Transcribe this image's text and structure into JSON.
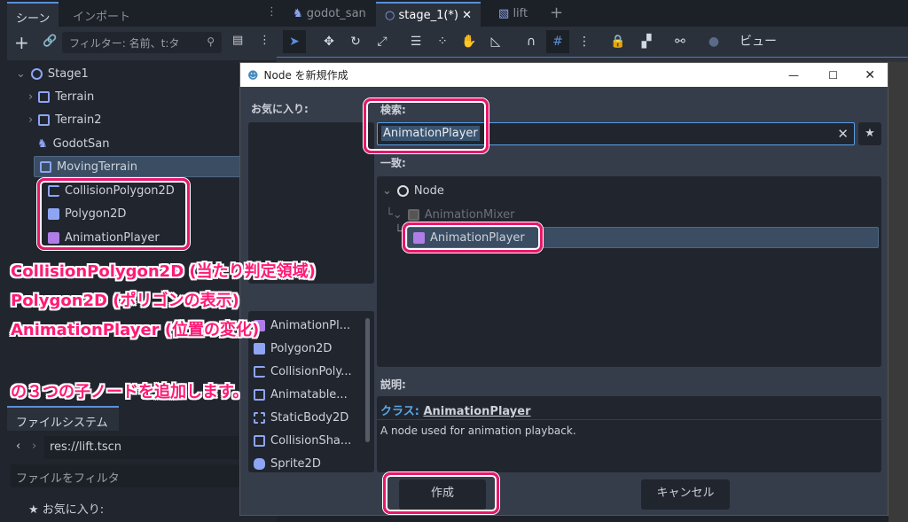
{
  "scene_dock": {
    "tabs": [
      "シーン",
      "インポート"
    ],
    "filter_placeholder": "フィルター: 名前、t:タ",
    "tree": [
      {
        "label": "Stage1"
      },
      {
        "label": "Terrain"
      },
      {
        "label": "Terrain2"
      },
      {
        "label": "GodotSan"
      },
      {
        "label": "MovingTerrain"
      },
      {
        "label": "CollisionPolygon2D"
      },
      {
        "label": "Polygon2D"
      },
      {
        "label": "AnimationPlayer"
      }
    ]
  },
  "annotations": [
    "CollisionPolygon2D (当たり判定領域)",
    "Polygon2D (ポリゴンの表示)",
    "AnimationPlayer (位置の変化)",
    "の３つの子ノードを追加します。"
  ],
  "filesystem": {
    "tab": "ファイルシステム",
    "path": "res://lift.tscn",
    "filter_placeholder": "ファイルをフィルタ",
    "favorites": "お気に入り:"
  },
  "editor": {
    "tabs": [
      "godot_san",
      "stage_1(*)",
      "lift"
    ],
    "view_menu": "ビュー"
  },
  "dialog": {
    "title": "Node を新規作成",
    "favorites_label": "お気に入り:",
    "search_label": "検索:",
    "search_value": "AnimationPlayer",
    "matches_label": "一致:",
    "matches": [
      "Node",
      "AnimationMixer",
      "AnimationPlayer"
    ],
    "recent": [
      "AnimationPl...",
      "Polygon2D",
      "CollisionPoly...",
      "Animatable...",
      "StaticBody2D",
      "CollisionSha...",
      "Sprite2D"
    ],
    "description_label": "説明:",
    "class_prefix": "クラス:",
    "class_name": "AnimationPlayer",
    "description": "A node used for animation playback.",
    "create": "作成",
    "cancel": "キャンセル"
  },
  "colors": {
    "accent": "#5a8fd8",
    "highlight": "#e8176b",
    "selection": "#3a4d63"
  }
}
